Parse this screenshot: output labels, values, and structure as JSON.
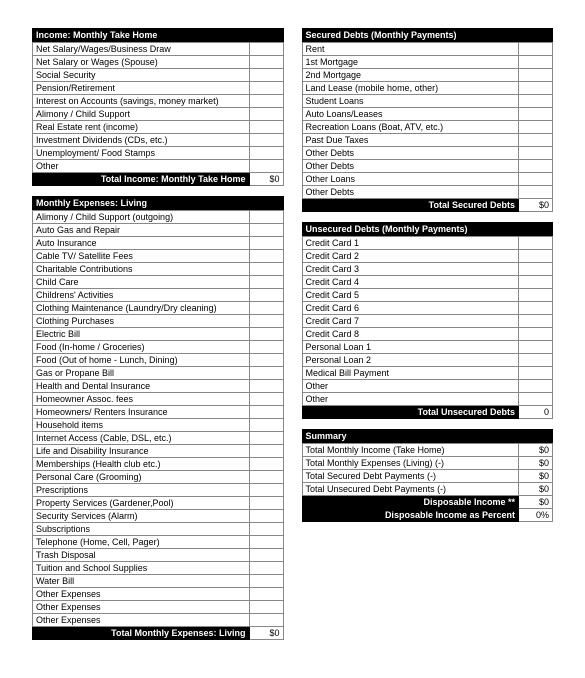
{
  "income": {
    "header": "Income: Monthly Take Home",
    "rows": [
      "Net Salary/Wages/Business Draw",
      "Net Salary or Wages (Spouse)",
      "Social Security",
      "Pension/Retirement",
      "Interest on Accounts (savings, money market)",
      "Alimony / Child Support",
      "Real Estate rent (income)",
      "Investment Dividends (CDs, etc.)",
      "Unemployment/ Food Stamps",
      "Other"
    ],
    "footer_label": "Total Income: Monthly Take Home",
    "footer_value": "$0"
  },
  "expenses": {
    "header": "Monthly Expenses: Living",
    "rows": [
      "Alimony / Child Support (outgoing)",
      "Auto Gas and Repair",
      "Auto Insurance",
      "Cable TV/ Satellite Fees",
      "Charitable Contributions",
      "Child Care",
      "Childrens' Activities",
      "Clothing Maintenance (Laundry/Dry cleaning)",
      "Clothing Purchases",
      "Electric Bill",
      "Food (In-home / Groceries)",
      "Food (Out of home - Lunch, Dining)",
      "Gas or Propane Bill",
      "Health and Dental Insurance",
      "Homeowner Assoc. fees",
      "Homeowners/ Renters Insurance",
      "Household items",
      "Internet Access (Cable, DSL, etc.)",
      "Life and Disability Insurance",
      "Memberships (Health club etc.)",
      "Personal Care (Grooming)",
      "Prescriptions",
      "Property Services (Gardener,Pool)",
      "Security Services (Alarm)",
      "Subscriptions",
      "Telephone (Home, Cell, Pager)",
      "Trash Disposal",
      "Tuition and School Supplies",
      "Water Bill",
      "Other Expenses",
      "Other Expenses",
      "Other Expenses"
    ],
    "footer_label": "Total Monthly Expenses: Living",
    "footer_value": "$0"
  },
  "secured": {
    "header": "Secured Debts (Monthly Payments)",
    "rows": [
      "Rent",
      "1st Mortgage",
      "2nd Mortgage",
      "Land Lease (mobile home, other)",
      "Student Loans",
      "Auto Loans/Leases",
      "Recreation Loans (Boat, ATV, etc.)",
      "Past Due Taxes",
      "Other Debts",
      "Other Debts",
      "Other Loans",
      "Other Debts"
    ],
    "footer_label": "Total Secured Debts",
    "footer_value": "$0"
  },
  "unsecured": {
    "header": "Unsecured Debts (Monthly Payments)",
    "rows": [
      "Credit Card 1",
      "Credit Card 2",
      "Credit Card 3",
      "Credit Card 4",
      "Credit Card 5",
      "Credit Card 6",
      "Credit Card 7",
      "Credit Card 8",
      "Personal Loan 1",
      "Personal Loan 2",
      "Medical Bill Payment",
      "Other",
      "Other"
    ],
    "footer_label": "Total Unsecured Debts",
    "footer_value": "0"
  },
  "summary": {
    "header": "Summary",
    "rows": [
      {
        "label": "Total Monthly Income (Take Home)",
        "value": "$0"
      },
      {
        "label": "Total Monthly Expenses (Living) (-)",
        "value": "$0"
      },
      {
        "label": "Total Secured Debt Payments (-)",
        "value": "$0"
      },
      {
        "label": "Total Unsecured Debt Payments (-)",
        "value": "$0"
      }
    ],
    "disposable_label": "Disposable Income **",
    "disposable_value": "$0",
    "percent_label": "Disposable Income as Percent",
    "percent_value": "0%"
  }
}
